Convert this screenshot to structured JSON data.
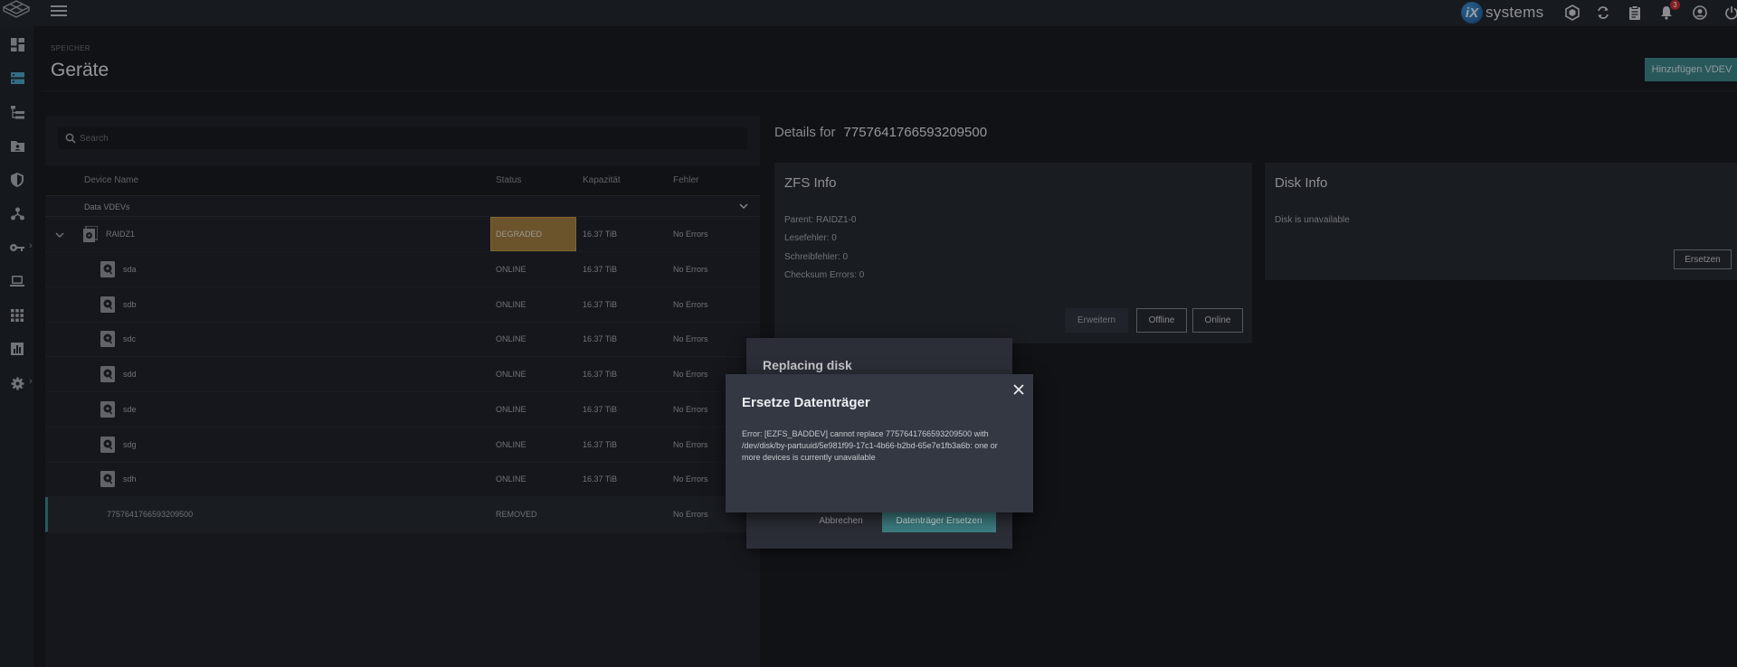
{
  "topbar": {
    "brand": "systems",
    "brand_mark": "iX",
    "notification_count": "3",
    "icons": [
      "truecommand-icon",
      "refresh-icon",
      "clipboard-icon",
      "bell-icon",
      "account-icon",
      "power-icon"
    ]
  },
  "sidebar": {
    "items": [
      "dashboard-icon",
      "storage-icon",
      "datasets-icon",
      "shares-icon",
      "data-protection-icon",
      "network-icon",
      "credentials-icon",
      "virtualization-icon",
      "apps-icon",
      "reporting-icon",
      "system-settings-icon"
    ]
  },
  "page": {
    "breadcrumb": "SPEICHER",
    "title": "Geräte",
    "add_vdev_label": "Hinzufügen VDEV"
  },
  "devices": {
    "search_placeholder": "Search",
    "columns": {
      "name": "Device Name",
      "status": "Status",
      "capacity": "Kapazität",
      "errors": "Fehler"
    },
    "group_label": "Data VDEVs",
    "vdev": {
      "name": "RAIDZ1",
      "status": "DEGRADED",
      "capacity": "16.37 TiB",
      "errors": "No Errors"
    },
    "disks": [
      {
        "name": "sda",
        "status": "ONLINE",
        "capacity": "16.37 TiB",
        "errors": "No Errors"
      },
      {
        "name": "sdb",
        "status": "ONLINE",
        "capacity": "16.37 TiB",
        "errors": "No Errors"
      },
      {
        "name": "sdc",
        "status": "ONLINE",
        "capacity": "16.37 TiB",
        "errors": "No Errors"
      },
      {
        "name": "sdd",
        "status": "ONLINE",
        "capacity": "16.37 TiB",
        "errors": "No Errors"
      },
      {
        "name": "sde",
        "status": "ONLINE",
        "capacity": "16.37 TiB",
        "errors": "No Errors"
      },
      {
        "name": "sdg",
        "status": "ONLINE",
        "capacity": "16.37 TiB",
        "errors": "No Errors"
      },
      {
        "name": "sdh",
        "status": "ONLINE",
        "capacity": "16.37 TiB",
        "errors": "No Errors"
      }
    ],
    "removed": {
      "name": "7757641766593209500",
      "status": "REMOVED",
      "capacity": "",
      "errors": "No Errors"
    }
  },
  "details": {
    "label": "Details for",
    "id": "7757641766593209500",
    "zfs": {
      "title": "ZFS Info",
      "parent": "Parent: RAIDZ1-0",
      "read_errors": "Lesefehler: 0",
      "write_errors": "Schreibfehler: 0",
      "checksum_errors": "Checksum Errors: 0",
      "extend_label": "Erweitern",
      "offline_label": "Offline",
      "online_label": "Online"
    },
    "disk": {
      "title": "Disk Info",
      "unavailable": "Disk is unavailable",
      "replace_label": "Ersetzen"
    }
  },
  "replacing_dialog": {
    "title": "Replacing disk",
    "cancel_label": "Abbrechen",
    "confirm_label": "Datenträger Ersetzen"
  },
  "error_dialog": {
    "title": "Ersetze Datenträger",
    "message": "Error: [EZFS_BADDEV] cannot replace 7757641766593209500 with /dev/disk/by-partuuid/5e981f99-17c1-4b66-b2bd-65e7e1fb3a6b: one or more devices is currently unavailable"
  }
}
